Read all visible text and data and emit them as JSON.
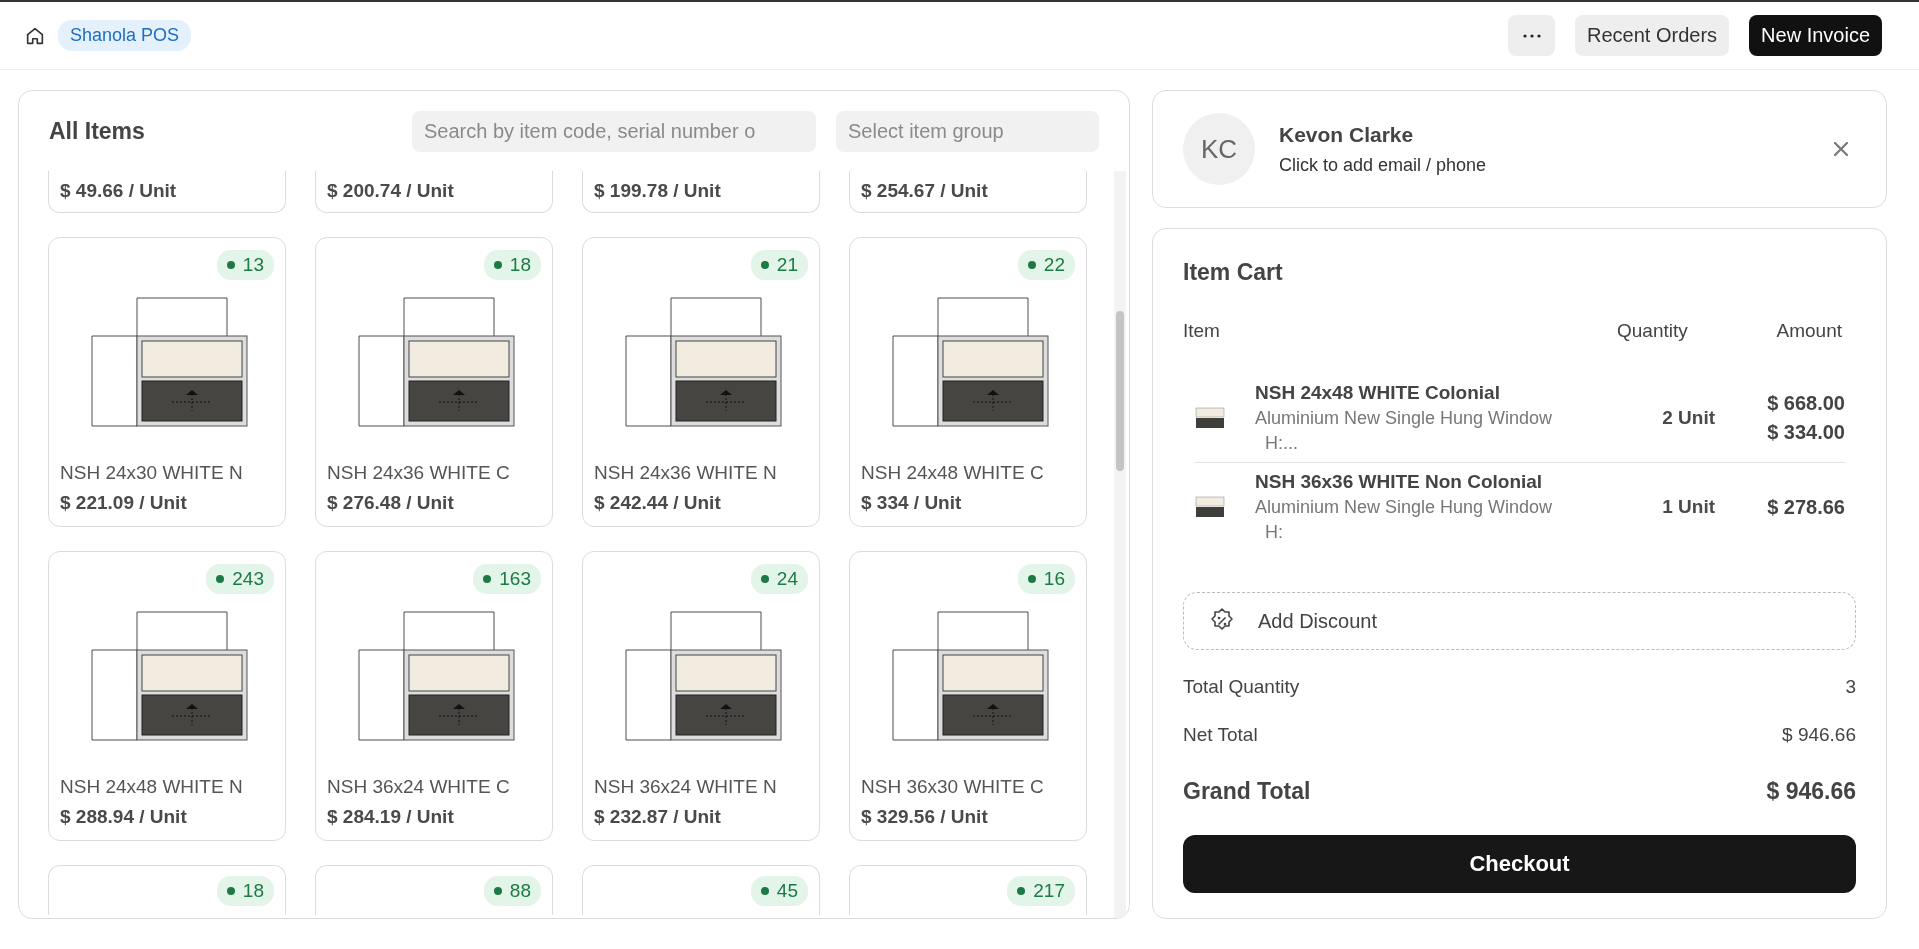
{
  "header": {
    "app_badge": "Shanola POS",
    "buttons": [
      {
        "label": "Recent Orders",
        "kind": "secondary"
      },
      {
        "label": "New Invoice",
        "kind": "primary"
      }
    ]
  },
  "items_panel": {
    "title": "All Items",
    "search": {
      "placeholder": "Search by item code, serial number o"
    },
    "group_select": {
      "placeholder": "Select item group"
    },
    "cut_top_row": [
      {
        "price": "$ 49.66 / Unit"
      },
      {
        "price": "$ 200.74 / Unit"
      },
      {
        "price": "$ 199.78 / Unit"
      },
      {
        "price": "$ 254.67 / Unit"
      }
    ],
    "items": [
      {
        "name": "NSH 24x30 WHITE N",
        "price": "$ 221.09 / Unit",
        "stock": "13"
      },
      {
        "name": "NSH 24x36 WHITE C",
        "price": "$ 276.48 / Unit",
        "stock": "18"
      },
      {
        "name": "NSH 24x36 WHITE N",
        "price": "$ 242.44 / Unit",
        "stock": "21"
      },
      {
        "name": "NSH 24x48 WHITE C",
        "price": "$ 334 / Unit",
        "stock": "22"
      },
      {
        "name": "NSH 24x48 WHITE N",
        "price": "$ 288.94 / Unit",
        "stock": "243"
      },
      {
        "name": "NSH 36x24 WHITE C",
        "price": "$ 284.19 / Unit",
        "stock": "163"
      },
      {
        "name": "NSH 36x24 WHITE N",
        "price": "$ 232.87 / Unit",
        "stock": "24"
      },
      {
        "name": "NSH 36x30 WHITE C",
        "price": "$ 329.56 / Unit",
        "stock": "16"
      }
    ],
    "cut_bottom_row": [
      {
        "stock": "18"
      },
      {
        "stock": "88"
      },
      {
        "stock": "45"
      },
      {
        "stock": "217"
      }
    ]
  },
  "customer": {
    "initials": "KC",
    "name": "Kevon Clarke",
    "contact_hint": "Click to add email / phone"
  },
  "cart": {
    "title": "Item Cart",
    "columns": [
      "Item",
      "Quantity",
      "Amount"
    ],
    "rows": [
      {
        "name": "NSH 24x48 WHITE Colonial",
        "description": "Aluminium New Single Hung Window",
        "description_more": "H:...",
        "quantity": "2 Unit",
        "amounts": [
          "$ 668.00",
          "$ 334.00"
        ]
      },
      {
        "name": "NSH 36x36 WHITE Non Colonial",
        "description": "Aluminium New Single Hung Window",
        "description_more": "H:",
        "quantity": "1 Unit",
        "amounts": [
          "$ 278.66"
        ]
      }
    ],
    "discount_label": "Add Discount",
    "totals": [
      {
        "label": "Total Quantity",
        "value": "3",
        "kind": "normal"
      },
      {
        "label": "Net Total",
        "value": "$ 946.66",
        "kind": "normal"
      },
      {
        "label": "Grand Total",
        "value": "$ 946.66",
        "kind": "grand"
      }
    ],
    "checkout": "Checkout"
  }
}
